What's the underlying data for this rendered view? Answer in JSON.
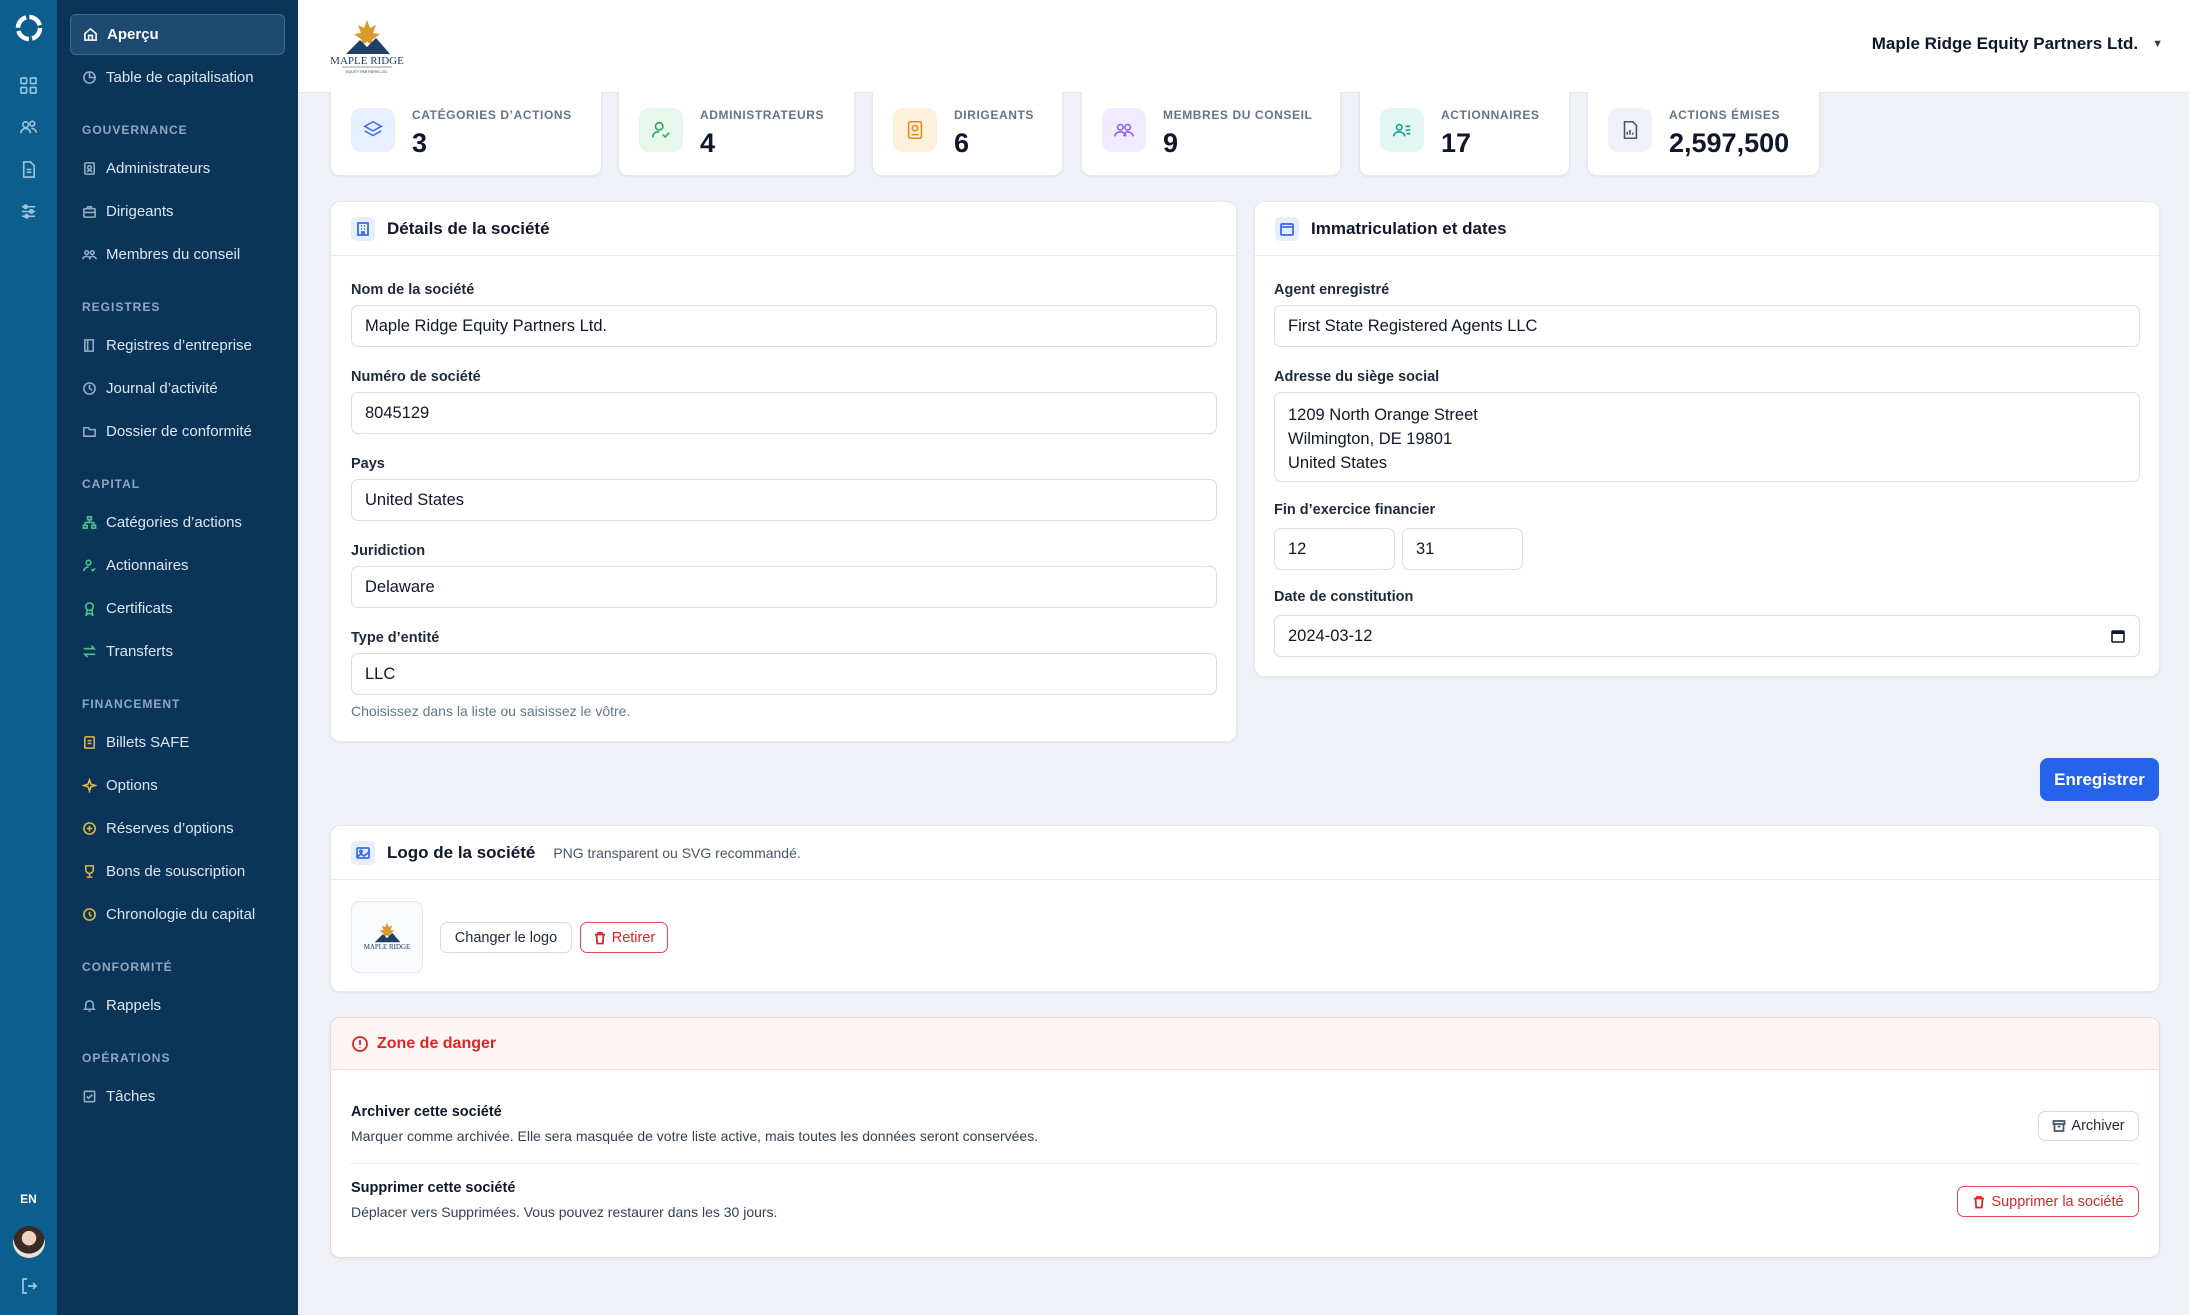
{
  "rail": {
    "lang": "EN",
    "icons": [
      "grid-icon",
      "users-icon",
      "document-icon",
      "sliders-icon"
    ]
  },
  "sidebar": {
    "items_top": [
      {
        "label": "Aperçu",
        "icon": "home-icon",
        "active": true
      },
      {
        "label": "Table de capitalisation",
        "icon": "pie-chart-icon"
      }
    ],
    "sections": [
      {
        "title": "GOUVERNANCE",
        "items": [
          "Administrateurs",
          "Dirigeants",
          "Membres du conseil"
        ]
      },
      {
        "title": "REGISTRES",
        "items": [
          "Registres d’entreprise",
          "Journal d’activité",
          "Dossier de conformité"
        ]
      },
      {
        "title": "CAPITAL",
        "items": [
          "Catégories d’actions",
          "Actionnaires",
          "Certificats",
          "Transferts"
        ]
      },
      {
        "title": "FINANCEMENT",
        "items": [
          "Billets SAFE",
          "Options",
          "Réserves d’options",
          "Bons de souscription",
          "Chronologie du capital"
        ]
      },
      {
        "title": "CONFORMITÉ",
        "items": [
          "Rappels"
        ]
      },
      {
        "title": "OPÉRATIONS",
        "items": [
          "Tâches"
        ]
      }
    ]
  },
  "header": {
    "company_name": "Maple Ridge Equity Partners Ltd.",
    "logo_text": "MAPLE RIDGE",
    "logo_subtext": "EQUITY PARTNERS LTD."
  },
  "stats": [
    {
      "label": "CATÉGORIES D’ACTIONS",
      "value": "3",
      "color": "#3b6ee6"
    },
    {
      "label": "ADMINISTRATEURS",
      "value": "4",
      "color": "#22a559"
    },
    {
      "label": "DIRIGEANTS",
      "value": "6",
      "color": "#e08a12"
    },
    {
      "label": "MEMBRES DU CONSEIL",
      "value": "9",
      "color": "#8b5cf6"
    },
    {
      "label": "ACTIONNAIRES",
      "value": "17",
      "color": "#0f9e8e"
    },
    {
      "label": "ACTIONS ÉMISES",
      "value": "2,597,500",
      "color": "#475569"
    }
  ],
  "details": {
    "title": "Détails de la société",
    "fields": [
      {
        "label": "Nom de la société",
        "value": "Maple Ridge Equity Partners Ltd."
      },
      {
        "label": "Numéro de société",
        "value": "8045129"
      },
      {
        "label": "Pays",
        "value": "United States"
      },
      {
        "label": "Juridiction",
        "value": "Delaware"
      },
      {
        "label": "Type d’entité",
        "value": "LLC"
      }
    ],
    "entity_help": "Choisissez dans la liste ou saisissez le vôtre."
  },
  "registration": {
    "title": "Immatriculation et dates",
    "agent_label": "Agent enregistré",
    "agent_value": "First State Registered Agents LLC",
    "address_label": "Adresse du siège social",
    "address_lines": [
      "1209 North Orange Street",
      "Wilmington, DE 19801",
      "United States"
    ],
    "fiscal_label": "Fin d’exercice financier",
    "fiscal_month": "12",
    "fiscal_day": "31",
    "incorporation_label": "Date de constitution",
    "incorporation_value": "2024-03-12"
  },
  "save_label": "Enregistrer",
  "logo_card": {
    "title": "Logo de la société",
    "subtitle": "PNG transparent ou SVG recommandé.",
    "change_label": "Changer le logo",
    "remove_label": "Retirer"
  },
  "danger": {
    "title": "Zone de danger",
    "archive_title": "Archiver cette société",
    "archive_desc": "Marquer comme archivée. Elle sera masquée de votre liste active, mais toutes les données seront conservées.",
    "archive_button": "Archiver",
    "delete_title": "Supprimer cette société",
    "delete_desc": "Déplacer vers Supprimées. Vous pouvez restaurer dans les 30 jours.",
    "delete_button": "Supprimer la société"
  }
}
